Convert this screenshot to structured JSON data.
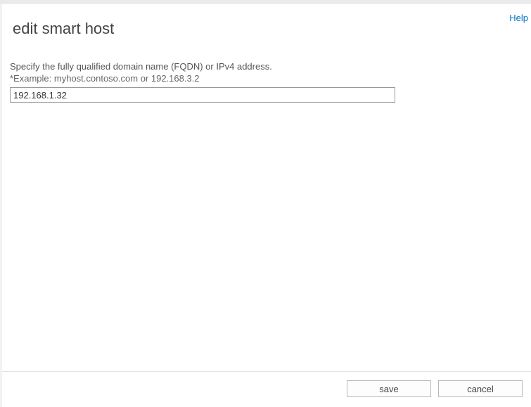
{
  "header": {
    "title": "edit smart host",
    "help_label": "Help"
  },
  "form": {
    "instruction": "Specify the fully qualified domain name (FQDN) or IPv4 address.",
    "example": "*Example: myhost.contoso.com or 192.168.3.2",
    "host_value": "192.168.1.32"
  },
  "buttons": {
    "save": "save",
    "cancel": "cancel"
  }
}
